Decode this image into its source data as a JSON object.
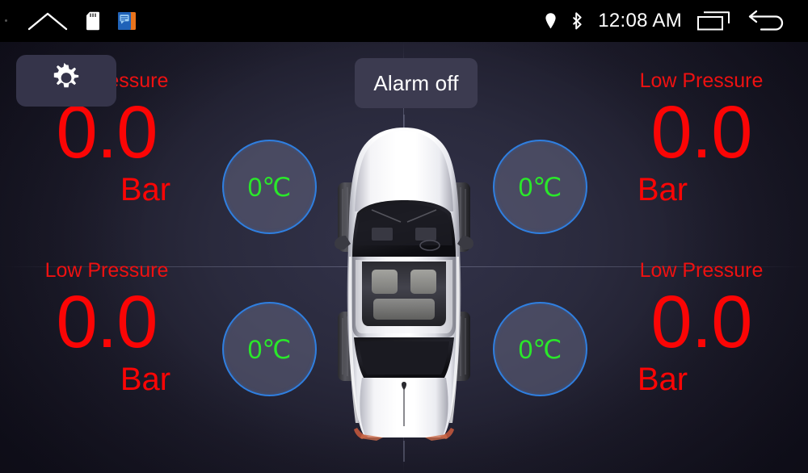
{
  "statusbar": {
    "time": "12:08 AM",
    "left_icons": [
      {
        "name": "home-icon"
      },
      {
        "name": "sd-card-icon"
      },
      {
        "name": "app-notification-icon"
      }
    ],
    "right_icons": [
      {
        "name": "location-pin-icon"
      },
      {
        "name": "bluetooth-icon"
      },
      {
        "name": "recent-apps-icon"
      },
      {
        "name": "back-icon"
      }
    ]
  },
  "toolbar": {
    "settings_icon": "gear-icon",
    "alarm_label": "Alarm off"
  },
  "colors": {
    "alert_red": "#fb0505",
    "temp_green": "#2ae82a",
    "circle_border_blue": "#2f7fe0",
    "button_bg": "#3c3b50",
    "panel_bg": "#2a2a3d"
  },
  "tires": [
    {
      "position": "front-left",
      "status": "Low Pressure",
      "pressure": "0.0",
      "unit": "Bar",
      "temperature": "0℃"
    },
    {
      "position": "front-right",
      "status": "Low Pressure",
      "pressure": "0.0",
      "unit": "Bar",
      "temperature": "0℃"
    },
    {
      "position": "rear-left",
      "status": "Low Pressure",
      "pressure": "0.0",
      "unit": "Bar",
      "temperature": "0℃"
    },
    {
      "position": "rear-right",
      "status": "Low Pressure",
      "pressure": "0.0",
      "unit": "Bar",
      "temperature": "0℃"
    }
  ],
  "vehicle": {
    "view": "top-down-car-illustration",
    "body_color": "#ffffff"
  }
}
